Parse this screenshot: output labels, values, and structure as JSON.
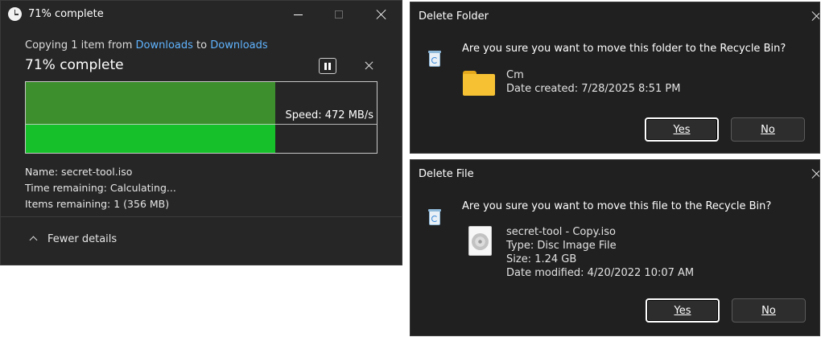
{
  "copy_window": {
    "title": "71% complete",
    "copy_prefix": "Copying 1 item from ",
    "source": "Downloads",
    "copy_mid": " to ",
    "destination": "Downloads",
    "status": "71% complete",
    "progress": 0.71,
    "speed": "Speed: 472 MB/s",
    "name_line": "Name:  secret-tool.iso",
    "time_line": "Time remaining:  Calculating...",
    "items_line": "Items remaining:  1 (356 MB)",
    "details_toggle": "Fewer details",
    "colors": {
      "graph_area": "#3c8f2c",
      "progress_bar": "#16c02a",
      "link": "#60b4ff"
    }
  },
  "folder_dialog": {
    "title": "Delete Folder",
    "question": "Are you sure you want to move this folder to the Recycle Bin?",
    "item_name": "Cm",
    "item_date": "Date created: 7/28/2025 8:51 PM",
    "yes_label": "Yes",
    "no_label": "No",
    "icons": [
      "recycle-bin-icon",
      "folder-icon",
      "close-icon"
    ]
  },
  "file_dialog": {
    "title": "Delete File",
    "question": "Are you sure you want to move this file to the Recycle Bin?",
    "item_name": "secret-tool - Copy.iso",
    "item_type": "Type: Disc Image File",
    "item_size": "Size: 1.24 GB",
    "item_modified": "Date modified: 4/20/2022 10:07 AM",
    "yes_label": "Yes",
    "no_label": "No",
    "icons": [
      "recycle-bin-icon",
      "disc-image-file-icon",
      "close-icon"
    ]
  }
}
